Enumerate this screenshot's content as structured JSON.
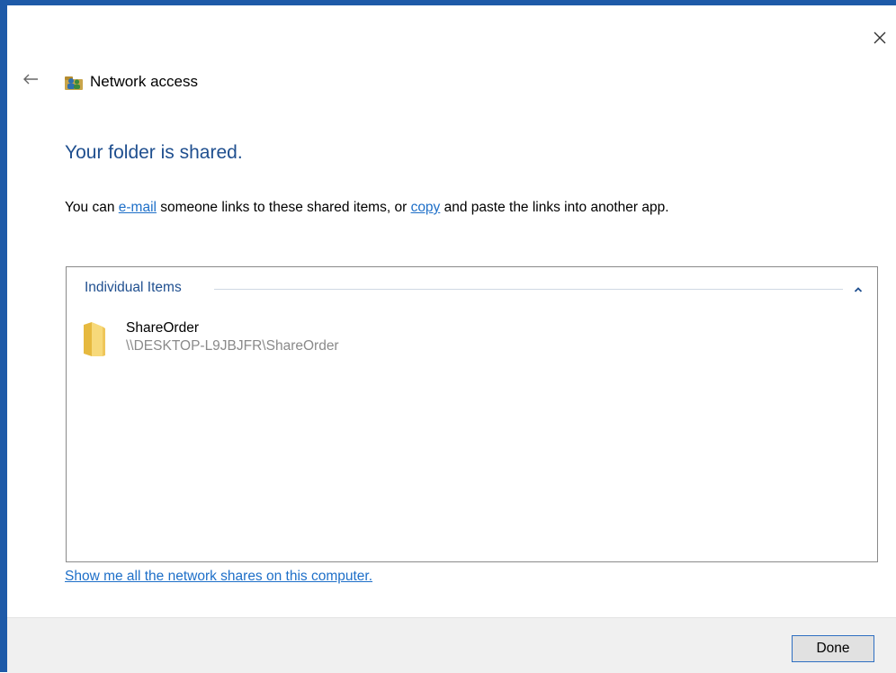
{
  "window": {
    "title": "Network access",
    "close_icon": "close-icon",
    "back_icon": "back-arrow-icon",
    "title_icon": "network-users-icon",
    "accent_color": "#1e5aa8"
  },
  "main": {
    "heading": "Your folder is shared.",
    "description": {
      "part1": "You can ",
      "email_link": "e-mail",
      "part2": " someone links to these shared items, or ",
      "copy_link": "copy",
      "part3": " and paste the links into another app."
    },
    "list": {
      "group_header": "Individual Items",
      "collapse_icon": "chevron-up-icon",
      "items": [
        {
          "name": "ShareOrder",
          "path": "\\\\DESKTOP-L9JBJFR\\ShareOrder",
          "icon": "folder-icon"
        }
      ]
    },
    "show_shares_link": "Show me all the network shares on this computer."
  },
  "footer": {
    "done_label": "Done"
  }
}
